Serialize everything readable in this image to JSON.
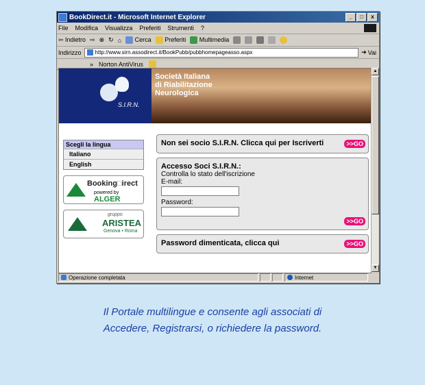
{
  "window": {
    "title": "BookDirect.it - Microsoft Internet Explorer",
    "min_btn": "_",
    "max_btn": "□",
    "close_btn": "x"
  },
  "menu": [
    "File",
    "Modifica",
    "Visualizza",
    "Preferiti",
    "Strumenti",
    "?"
  ],
  "toolbar": {
    "back": "⇦ Indietro",
    "fwd": "⇨",
    "stop": "⊗",
    "refresh": "↻",
    "home": "⌂",
    "search": "Cerca",
    "favorites": "Preferiti",
    "media": "Multimedia"
  },
  "address": {
    "label": "Indirizzo",
    "url": "http://www.sirn.assodirect.it/BookPubb/pubbhomepageasso.aspx",
    "go": "Vai"
  },
  "links": {
    "chev": "»",
    "item": "Norton AntiVirus"
  },
  "banner": {
    "line1": "Società Italiana",
    "line2": "di Riabilitazione",
    "line3": "Neurologica",
    "sirn": "S.I.R.N."
  },
  "lang": {
    "header": "Scegli la lingua",
    "items": [
      "Italiano",
      "English"
    ]
  },
  "logos": {
    "booking1": "Booking",
    "booking2": "irect",
    "booking_sub": "powered by",
    "alger": "ALGER",
    "gruppo": "gruppo",
    "aristea": "ARISTEA",
    "genova": "Genova • Roma"
  },
  "panels": {
    "register": "Non sei socio S.I.R.N. Clicca qui per Iscriverti",
    "access_title": "Accesso Soci S.I.R.N.:",
    "access_sub": "Controlla lo stato dell'iscrizione",
    "email_label": "E-mail:",
    "password_label": "Password:",
    "forgot": "Password dimenticata, clicca qui",
    "go": ">>GO"
  },
  "status": {
    "text": "Operazione completata",
    "zone": "Internet"
  },
  "caption": {
    "line1": "Il Portale multilingue e consente agli associati di",
    "line2": "Accedere, Registrarsi,  o richiedere la password."
  }
}
